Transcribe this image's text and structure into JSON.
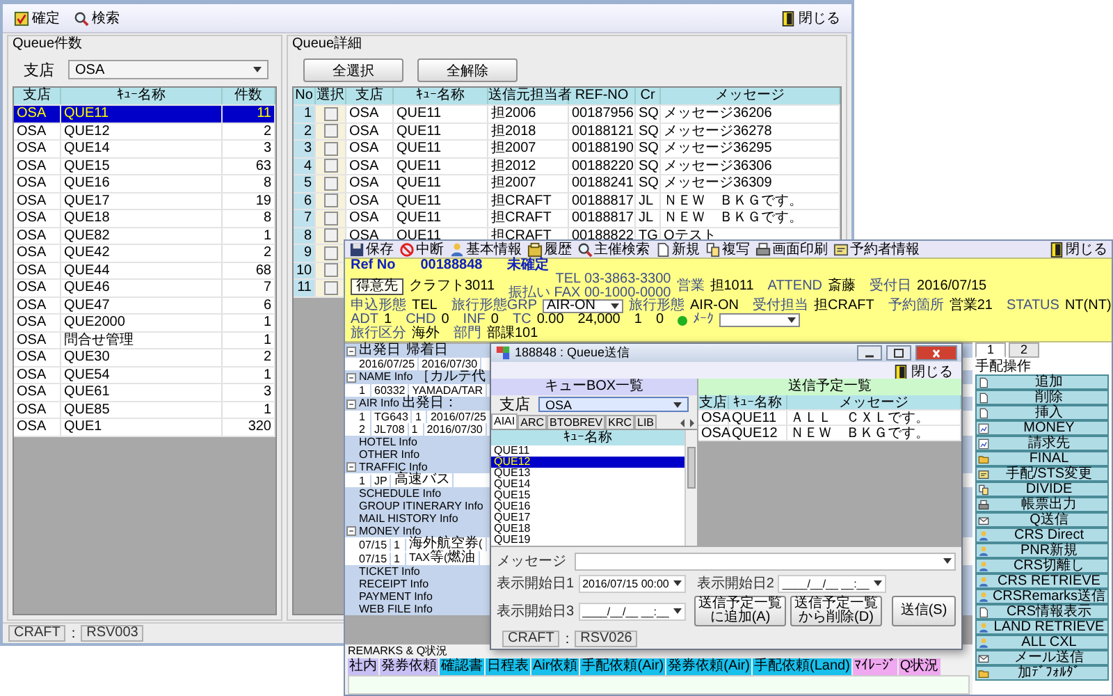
{
  "main_window": {
    "toolbar": [
      "確定",
      "検索"
    ],
    "close_label": "閉じる",
    "queue_counts": {
      "title": "Queue件数",
      "branch_label": "支店",
      "branch": "OSA",
      "columns": [
        "支店",
        "ｷｭｰ名称",
        "件数"
      ],
      "rows": [
        {
          "branch": "OSA",
          "queue": "QUE11",
          "count": "11",
          "selected": true
        },
        {
          "branch": "OSA",
          "queue": "QUE12",
          "count": "2",
          "selected": false
        },
        {
          "branch": "OSA",
          "queue": "QUE14",
          "count": "3",
          "selected": false
        },
        {
          "branch": "OSA",
          "queue": "QUE15",
          "count": "63",
          "selected": false
        },
        {
          "branch": "OSA",
          "queue": "QUE16",
          "count": "8",
          "selected": false
        },
        {
          "branch": "OSA",
          "queue": "QUE17",
          "count": "19",
          "selected": false
        },
        {
          "branch": "OSA",
          "queue": "QUE18",
          "count": "8",
          "selected": false
        },
        {
          "branch": "OSA",
          "queue": "QUE82",
          "count": "1",
          "selected": false
        },
        {
          "branch": "OSA",
          "queue": "QUE42",
          "count": "2",
          "selected": false
        },
        {
          "branch": "OSA",
          "queue": "QUE44",
          "count": "68",
          "selected": false
        },
        {
          "branch": "OSA",
          "queue": "QUE46",
          "count": "7",
          "selected": false
        },
        {
          "branch": "OSA",
          "queue": "QUE47",
          "count": "6",
          "selected": false
        },
        {
          "branch": "OSA",
          "queue": "QUE2000",
          "count": "1",
          "selected": false
        },
        {
          "branch": "OSA",
          "queue": "問合せ管理",
          "count": "1",
          "selected": false
        },
        {
          "branch": "OSA",
          "queue": "QUE30",
          "count": "2",
          "selected": false
        },
        {
          "branch": "OSA",
          "queue": "QUE54",
          "count": "1",
          "selected": false
        },
        {
          "branch": "OSA",
          "queue": "QUE61",
          "count": "3",
          "selected": false
        },
        {
          "branch": "OSA",
          "queue": "QUE85",
          "count": "1",
          "selected": false
        },
        {
          "branch": "OSA",
          "queue": "QUE1",
          "count": "320",
          "selected": false
        }
      ]
    },
    "queue_detail": {
      "title": "Queue詳細",
      "buttons": [
        "全選択",
        "全解除"
      ],
      "columns": [
        "No",
        "選択",
        "支店",
        "ｷｭｰ名称",
        "送信元担当者",
        "REF-NO",
        "Cr",
        "メッセージ"
      ],
      "rows": [
        {
          "no": "1",
          "checked": false,
          "cells": [
            "OSA",
            "QUE11",
            "担2006",
            "00187956",
            "SQ",
            "メッセージ36206"
          ]
        },
        {
          "no": "2",
          "checked": false,
          "cells": [
            "OSA",
            "QUE11",
            "担2018",
            "00188121",
            "SQ",
            "メッセージ36278"
          ]
        },
        {
          "no": "3",
          "checked": false,
          "cells": [
            "OSA",
            "QUE11",
            "担2007",
            "00188190",
            "SQ",
            "メッセージ36295"
          ]
        },
        {
          "no": "4",
          "checked": false,
          "cells": [
            "OSA",
            "QUE11",
            "担2012",
            "00188220",
            "SQ",
            "メッセージ36306"
          ]
        },
        {
          "no": "5",
          "checked": false,
          "cells": [
            "OSA",
            "QUE11",
            "担2007",
            "00188241",
            "SQ",
            "メッセージ36309"
          ]
        },
        {
          "no": "6",
          "checked": false,
          "cells": [
            "OSA",
            "QUE11",
            "担CRAFT",
            "00188817",
            "JL",
            "ＮＥＷ　ＢＫＧです。"
          ]
        },
        {
          "no": "7",
          "checked": false,
          "cells": [
            "OSA",
            "QUE11",
            "担CRAFT",
            "00188817",
            "JL",
            "ＮＥＷ　ＢＫＧです。"
          ]
        },
        {
          "no": "8",
          "checked": false,
          "cells": [
            "OSA",
            "QUE11",
            "担CRAFT",
            "00188822",
            "TG",
            "Qテスト"
          ]
        },
        {
          "no": "9",
          "checked": false
        },
        {
          "no": "10",
          "checked": false
        },
        {
          "no": "11",
          "checked": false
        }
      ]
    },
    "status_bar": {
      "user": "CRAFT",
      "separator": ":",
      "screen": "RSV003"
    }
  },
  "booking_window": {
    "toolbar": [
      "保存",
      "中断",
      "基本情報",
      "履歴",
      "主催検索",
      "新規",
      "複写",
      "画面印刷",
      "予約者情報"
    ],
    "close_label": "閉じる",
    "header_lines": [
      [
        {
          "kind": "title",
          "text": "Ref No"
        },
        {
          "kind": "title",
          "text": "00188848"
        },
        {
          "kind": "title",
          "text": "未確定"
        }
      ],
      [
        {
          "kind": "button",
          "text": "得意先"
        },
        {
          "kind": "value",
          "text": "クラフト3011"
        },
        {
          "kind": "stack",
          "lines": [
            "TEL 03-3863-3300",
            "振払い FAX 00-1000-0000"
          ]
        },
        {
          "kind": "label",
          "text": "営業"
        },
        {
          "kind": "value",
          "text": "担1011"
        },
        {
          "kind": "label",
          "text": "ATTEND"
        },
        {
          "kind": "value",
          "text": "斎藤"
        },
        {
          "kind": "label",
          "text": "受付日"
        },
        {
          "kind": "value",
          "text": "2016/07/15"
        }
      ],
      [
        {
          "kind": "label",
          "text": "申込形態"
        },
        {
          "kind": "value",
          "text": "TEL"
        },
        {
          "kind": "label",
          "text": "旅行形態GRP"
        },
        {
          "kind": "select",
          "text": "AIR-ON"
        },
        {
          "kind": "label",
          "text": "旅行形態"
        },
        {
          "kind": "value",
          "text": "AIR-ON"
        },
        {
          "kind": "label",
          "text": "受付担当"
        },
        {
          "kind": "value",
          "text": "担CRAFT"
        },
        {
          "kind": "label",
          "text": "予約箇所"
        },
        {
          "kind": "value",
          "text": "営業21"
        },
        {
          "kind": "label",
          "text": "STATUS"
        },
        {
          "kind": "value",
          "text": "NT(NT)"
        }
      ],
      [
        {
          "kind": "label",
          "text": "ADT"
        },
        {
          "kind": "value",
          "text": "1"
        },
        {
          "kind": "label",
          "text": "CHD"
        },
        {
          "kind": "value",
          "text": "0"
        },
        {
          "kind": "label",
          "text": "INF"
        },
        {
          "kind": "value",
          "text": "0"
        },
        {
          "kind": "label",
          "text": "TC"
        },
        {
          "kind": "value",
          "text": "0.00"
        },
        {
          "kind": "value",
          "text": "24,000"
        },
        {
          "kind": "value",
          "text": "1"
        },
        {
          "kind": "value",
          "text": "0"
        },
        {
          "kind": "dot",
          "color": "#20b020"
        },
        {
          "kind": "label",
          "text": "ﾒｰｸ"
        },
        {
          "kind": "select"
        }
      ],
      [
        {
          "kind": "label",
          "text": "旅行区分"
        },
        {
          "kind": "value",
          "text": "海外"
        },
        {
          "kind": "label",
          "text": "部門"
        },
        {
          "kind": "value",
          "text": "部課101"
        }
      ]
    ],
    "tree": [
      {
        "cells": [
          "出発日",
          "帰着日"
        ],
        "expanded": true,
        "children": [
          {
            "cells": [
              "2016/07/25",
              "2016/07/30"
            ]
          }
        ]
      },
      {
        "cells": [
          "NAME Info ［カルテ代"
        ],
        "expanded": true,
        "children": [
          {
            "cells": [
              "1",
              "60332",
              "YAMADA/TAR"
            ]
          }
        ]
      },
      {
        "cells": [
          "AIR Info 出発日："
        ],
        "expanded": true,
        "children": [
          {
            "cells": [
              "1",
              "TG643",
              "1",
              "2016/07/25"
            ]
          },
          {
            "cells": [
              "2",
              "JL708",
              "1",
              "2016/07/30"
            ]
          }
        ]
      },
      {
        "cells": [
          "HOTEL Info"
        ]
      },
      {
        "cells": [
          "OTHER Info"
        ]
      },
      {
        "cells": [
          "TRAFFIC Info"
        ],
        "expanded": true,
        "children": [
          {
            "cells": [
              "1",
              "JP",
              "高速バス"
            ]
          }
        ]
      },
      {
        "cells": [
          "SCHEDULE Info"
        ]
      },
      {
        "cells": [
          "GROUP ITINERARY Info"
        ]
      },
      {
        "cells": [
          "MAIL HISTORY Info"
        ]
      },
      {
        "cells": [
          "MONEY Info"
        ],
        "expanded": true,
        "children": [
          {
            "cells": [
              "07/15",
              "1",
              "海外航空券("
            ]
          },
          {
            "cells": [
              "07/15",
              "1",
              "TAX等(燃油"
            ]
          }
        ]
      },
      {
        "cells": [
          "TICKET Info"
        ]
      },
      {
        "cells": [
          "RECEIPT Info"
        ]
      },
      {
        "cells": [
          "PAYMENT Info"
        ]
      },
      {
        "cells": [
          "WEB FILE Info"
        ]
      }
    ],
    "side_tabs": [
      {
        "label": "1",
        "selected": true
      },
      {
        "label": "2",
        "selected": false
      }
    ],
    "side_title": "手配操作",
    "side_buttons": [
      "追加",
      "削除",
      "挿入",
      "MONEY",
      "請求先",
      "FINAL",
      "手配/STS変更",
      "DIVIDE",
      "帳票出力",
      "Q送信",
      "CRS Direct",
      "PNR新規",
      "CRS切離し",
      "CRS RETRIEVE",
      "CRSRemarks送信",
      "CRS情報表示",
      "LAND RETRIEVE",
      "ALL CXL",
      "メール送信",
      "加ﾃﾞﾌｫﾙﾀﾞ"
    ],
    "remarks_title": "REMARKS & Q状況",
    "remarks_tabs": [
      {
        "label": "社内",
        "color": "#c8c0f4"
      },
      {
        "label": "発券依頼",
        "color": "#c8c0f4"
      },
      {
        "label": "確認書",
        "color": "#18c0ec"
      },
      {
        "label": "日程表",
        "color": "#18c0ec"
      },
      {
        "label": "Air依頼",
        "color": "#18c0ec"
      },
      {
        "label": "手配依頼(Air)",
        "color": "#18c0ec"
      },
      {
        "label": "発券依頼(Air)",
        "color": "#18c0ec"
      },
      {
        "label": "手配依頼(Land)",
        "color": "#18c0ec"
      },
      {
        "label": "ﾏｲﾚｰｼﾞ",
        "color": "#f0a8f0"
      },
      {
        "label": "Q状況",
        "color": "#f0a8f0"
      }
    ]
  },
  "dialog": {
    "title": "188848 : Queue送信",
    "close_label": "閉じる",
    "left_title": "キューBOX一覧",
    "right_title": "送信予定一覧",
    "branch_label": "支店",
    "branch": "OSA",
    "tabs": [
      {
        "label": "AIAI",
        "selected": true
      },
      {
        "label": "ARC",
        "selected": false
      },
      {
        "label": "BTOBREV",
        "selected": false
      },
      {
        "label": "KRC",
        "selected": false
      },
      {
        "label": "LIB",
        "selected": false
      }
    ],
    "list_column": "ｷｭｰ名称",
    "queues": [
      {
        "name": "QUE11",
        "selected": false
      },
      {
        "name": "QUE12",
        "selected": true
      },
      {
        "name": "QUE13",
        "selected": false
      },
      {
        "name": "QUE14",
        "selected": false
      },
      {
        "name": "QUE15",
        "selected": false
      },
      {
        "name": "QUE16",
        "selected": false
      },
      {
        "name": "QUE17",
        "selected": false
      },
      {
        "name": "QUE18",
        "selected": false
      },
      {
        "name": "QUE19",
        "selected": false
      }
    ],
    "send_columns": [
      "支店",
      "ｷｭｰ名称",
      "メッセージ"
    ],
    "send_rows": [
      [
        "OSA",
        "QUE11",
        "ＡＬＬ　ＣＸＬです。"
      ],
      [
        "OSA",
        "QUE12",
        "ＮＥＷ　ＢＫＧです。"
      ]
    ],
    "message_label": "メッセージ",
    "dates": [
      {
        "label": "表示開始日1",
        "value": "2016/07/15 00:00"
      },
      {
        "label": "表示開始日2",
        "value": "____/__/__ __:__"
      },
      {
        "label": "表示開始日3",
        "value": "____/__/__ __:__"
      }
    ],
    "buttons": [
      "送信予定一覧に追加(A)",
      "送信予定一覧から削除(D)",
      "送信(S)"
    ],
    "status": {
      "user": "CRAFT",
      "separator": ":",
      "screen": "RSV026"
    }
  }
}
